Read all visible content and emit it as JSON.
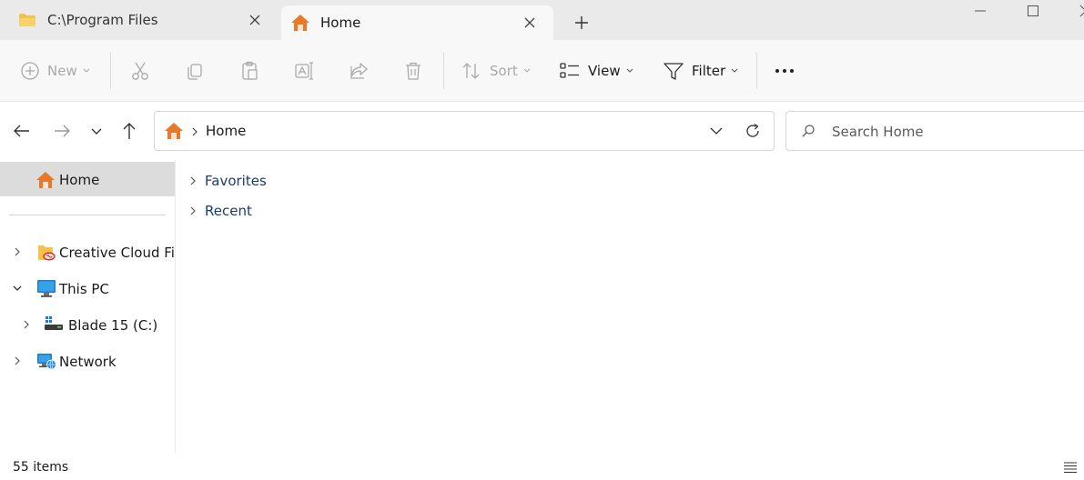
{
  "tabs": [
    {
      "label": "C:\\Program Files",
      "icon": "folder-icon",
      "active": false
    },
    {
      "label": "Home",
      "icon": "home-icon",
      "active": true
    }
  ],
  "toolbar": {
    "new_label": "New",
    "sort_label": "Sort",
    "view_label": "View",
    "filter_label": "Filter"
  },
  "address": {
    "crumb": "Home"
  },
  "search": {
    "placeholder": "Search Home"
  },
  "sidebar": {
    "home_label": "Home",
    "items": [
      {
        "label": "Creative Cloud Files",
        "expanded": false
      },
      {
        "label": "This PC",
        "expanded": true
      },
      {
        "label": "Blade 15 (C:)",
        "expanded": false
      },
      {
        "label": "Network",
        "expanded": false
      }
    ]
  },
  "content": {
    "groups": [
      {
        "label": "Favorites"
      },
      {
        "label": "Recent"
      }
    ]
  },
  "status": {
    "item_count": "55 items"
  },
  "colors": {
    "titlebar_bg": "#eaeaea",
    "active_tab_bg": "#f8f8f8",
    "selected_nav_bg": "#dcdcdc",
    "home_orange": "#e8782a",
    "group_text": "#1b3d6e"
  }
}
